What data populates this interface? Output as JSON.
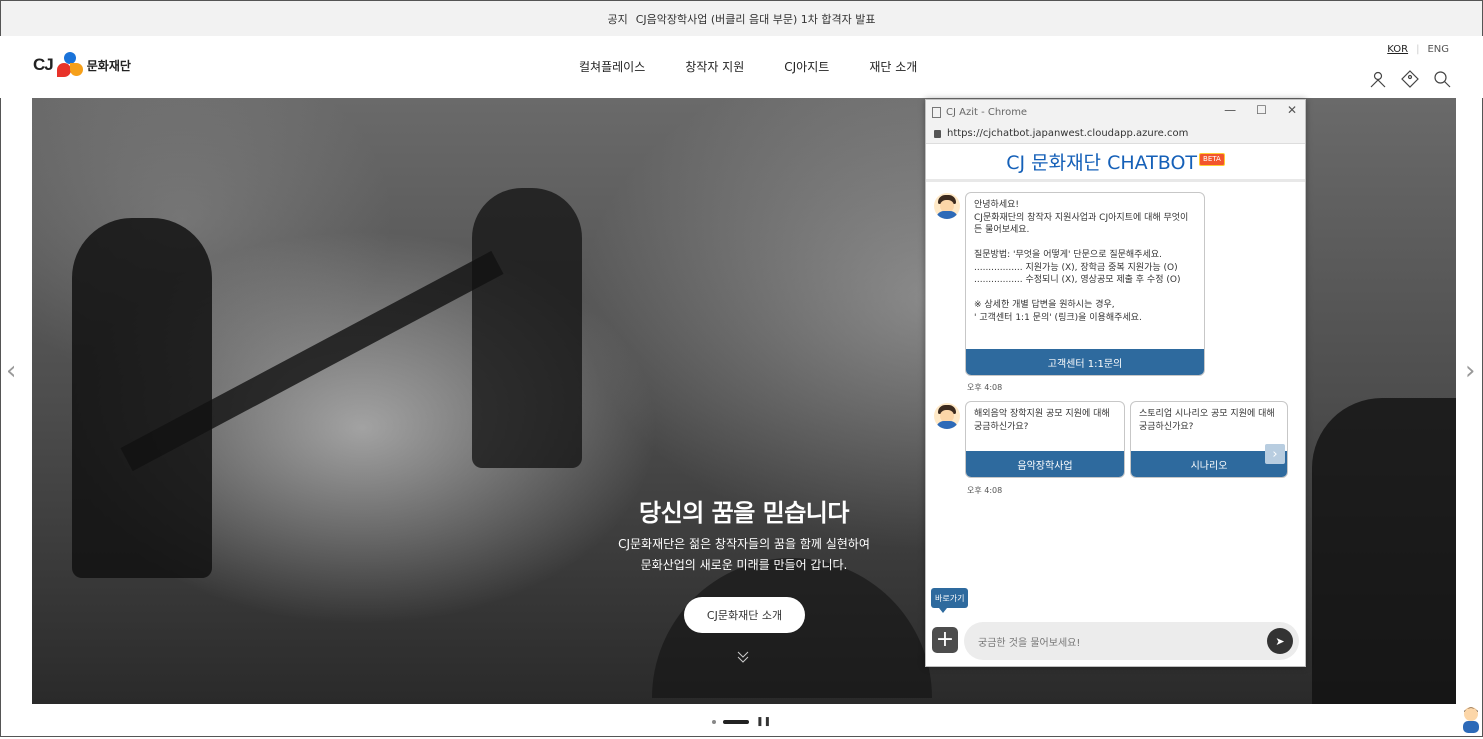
{
  "notice": {
    "label": "공지",
    "text": "CJ음악장학사업 (버클리 음대 부문) 1차 합격자 발표"
  },
  "header": {
    "logo_cj": "CJ",
    "logo_text": "문화재단",
    "nav": [
      "컬쳐플레이스",
      "창작자 지원",
      "CJ아지트",
      "재단 소개"
    ],
    "lang_kor": "KOR",
    "lang_eng": "ENG"
  },
  "hero": {
    "title": "당신의 꿈을 믿습니다",
    "subtitle_line1": "CJ문화재단은 젊은 창작자들의 꿈을 함께 실현하여",
    "subtitle_line2": "문화산업의 새로운 미래를 만들어 갑니다.",
    "button": "CJ문화재단 소개",
    "prev_arrow": "‹",
    "next_arrow": "›"
  },
  "chat": {
    "window_title": "CJ Azit - Chrome",
    "url": "https://cjchatbot.japanwest.cloudapp.azure.com",
    "header_title": "CJ 문화재단 CHATBOT",
    "beta": "BETA",
    "greeting": "안녕하세요!\nCJ문화재단의 창작자 지원사업과 CJ아지트에 대해 무엇이든 물어보세요.\n\n질문방법: '무엇을 어떻게' 단문으로 질문해주세요.\n................. 지원가능 (X), 장학금 중복 지원가능 (O)\n................. 수정되니 (X), 영상공모 제출 후 수정 (O)\n\n※ 상세한 개별 답변을 원하시는 경우,\n' 고객센터 1:1 문의' (링크)을 이용해주세요.",
    "greeting_button": "고객센터 1:1문의",
    "time1": "오후 4:08",
    "card1_text": "해외음악 장학지원 공모 지원에 대해 궁금하신가요?",
    "card1_button": "음악장학사업",
    "card2_text": "스토리업 시나리오 공모 지원에 대해 궁금하신가요?",
    "card2_button": "시나리오",
    "time2": "오후 4:08",
    "quick_label": "바로가기",
    "input_placeholder": "궁금한 것을 물어보세요!"
  }
}
